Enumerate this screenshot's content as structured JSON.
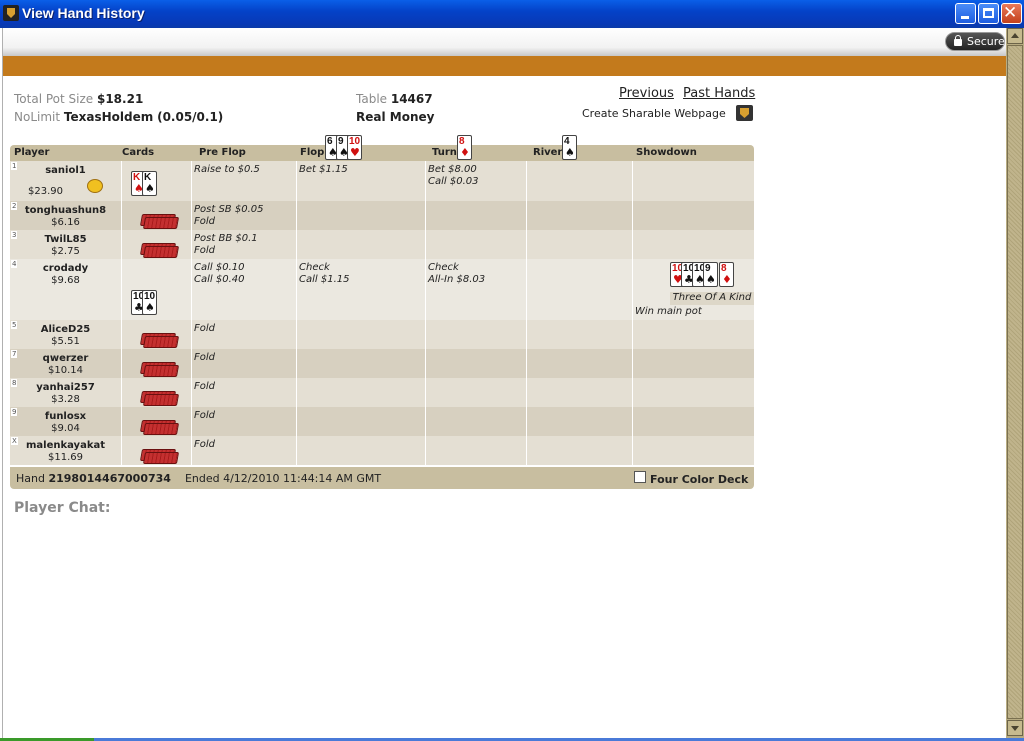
{
  "window": {
    "title": "View Hand History"
  },
  "toolbar": {
    "secure_label": "Secure"
  },
  "info": {
    "pot_label": "Total Pot Size",
    "pot_value": "$18.21",
    "game_prefix": "NoLimit",
    "game_name": "TexasHoldem",
    "stakes": "(0.05/0.1)",
    "table_label": "Table",
    "table_value": "14467",
    "money": "Real Money"
  },
  "links": {
    "previous": "Previous",
    "past_hands": "Past Hands",
    "sharable": "Create Sharable Webpage"
  },
  "headers": {
    "player": "Player",
    "cards": "Cards",
    "preflop": "Pre Flop",
    "flop": "Flop",
    "turn": "Turn",
    "river": "River",
    "showdown": "Showdown"
  },
  "board": {
    "flop": [
      {
        "rank": "6",
        "suit": "♠",
        "color": "black"
      },
      {
        "rank": "9",
        "suit": "♠",
        "color": "black"
      },
      {
        "rank": "10",
        "suit": "♥",
        "color": "red"
      }
    ],
    "turn": [
      {
        "rank": "8",
        "suit": "♦",
        "color": "red"
      }
    ],
    "river": [
      {
        "rank": "4",
        "suit": "♠",
        "color": "black"
      }
    ]
  },
  "players": [
    {
      "seat": "1",
      "name": "saniol1",
      "stack": "$23.90",
      "preflop": [
        "Raise to $0.5"
      ],
      "flop": [
        "Bet $1.15"
      ],
      "turn": [
        "Bet $8.00",
        "Call $0.03"
      ],
      "cards": [
        {
          "rank": "K",
          "suit": "♠",
          "color": "red"
        },
        {
          "rank": "K",
          "suit": "♠",
          "color": "black"
        }
      ]
    },
    {
      "seat": "2",
      "name": "tonghuashun8",
      "stack": "$6.16",
      "preflop": [
        "Post SB $0.05",
        "Fold"
      ]
    },
    {
      "seat": "3",
      "name": "TwilL85",
      "stack": "$2.75",
      "preflop": [
        "Post BB $0.1",
        "Fold"
      ]
    },
    {
      "seat": "4",
      "name": "crodady",
      "stack": "$9.68",
      "preflop": [
        "Call $0.10",
        "Call $0.40"
      ],
      "flop": [
        "Check",
        "Call $1.15"
      ],
      "turn": [
        "Check",
        "All-In $8.03"
      ],
      "cards": [
        {
          "rank": "10",
          "suit": "♣",
          "color": "black"
        },
        {
          "rank": "10",
          "suit": "♠",
          "color": "black"
        }
      ],
      "showdown_cards": [
        {
          "rank": "10",
          "suit": "♥",
          "color": "red"
        },
        {
          "rank": "10",
          "suit": "♣",
          "color": "black"
        },
        {
          "rank": "10",
          "suit": "♠",
          "color": "black"
        },
        {
          "rank": "9",
          "suit": "♠",
          "color": "black"
        },
        {
          "rank": "8",
          "suit": "♦",
          "color": "red"
        }
      ],
      "hand_rank": "Three Of A Kind",
      "result": "Win main pot"
    },
    {
      "seat": "5",
      "name": "AliceD25",
      "stack": "$5.51",
      "preflop": [
        "Fold"
      ]
    },
    {
      "seat": "7",
      "name": "qwerzer",
      "stack": "$10.14",
      "preflop": [
        "Fold"
      ]
    },
    {
      "seat": "8",
      "name": "yanhai257",
      "stack": "$3.28",
      "preflop": [
        "Fold"
      ]
    },
    {
      "seat": "9",
      "name": "funlosx",
      "stack": "$9.04",
      "preflop": [
        "Fold"
      ]
    },
    {
      "seat": "X",
      "name": "malenkayakat",
      "stack": "$11.69",
      "preflop": [
        "Fold"
      ]
    }
  ],
  "footer": {
    "hand_label": "Hand",
    "hand_id": "2198014467000734",
    "ended": "Ended 4/12/2010 11:44:14 AM GMT",
    "four_color": "Four Color Deck"
  },
  "chat": {
    "label": "Player Chat:"
  }
}
